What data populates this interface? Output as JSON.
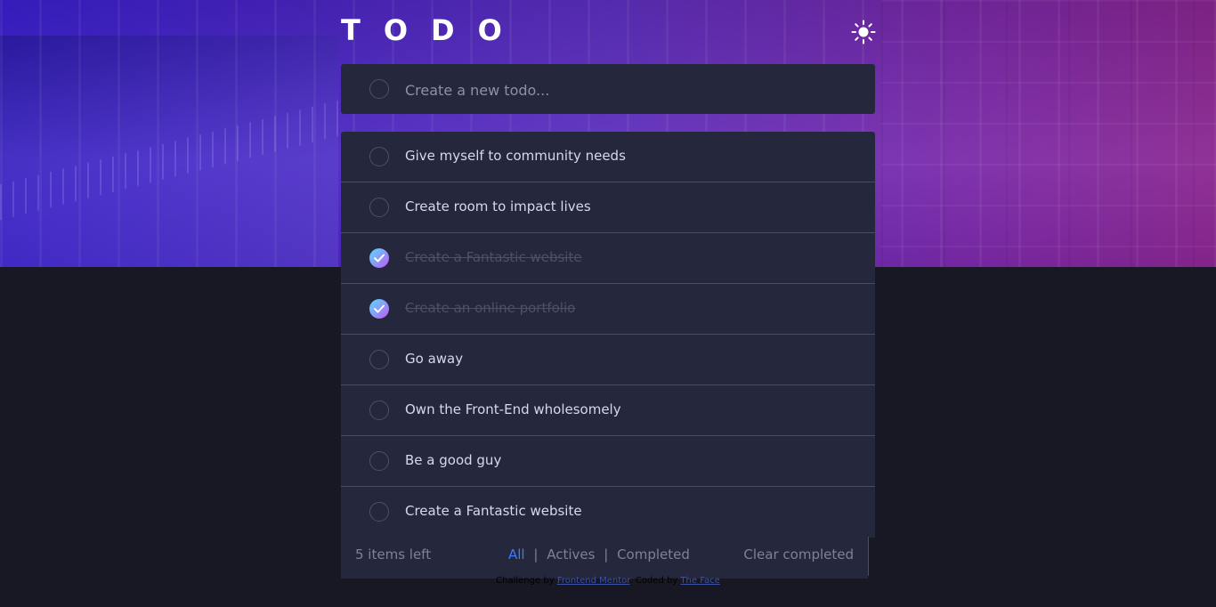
{
  "app": {
    "title": "TODO",
    "theme_icon": "sun-icon"
  },
  "colors": {
    "hero_gradient_start": "#3a1fcf",
    "hero_gradient_end": "#8a2590",
    "card_bg": "#25273c",
    "page_bg": "#181824",
    "active_filter": "#3a7cfd",
    "check_gradient_start": "#57ddff",
    "check_gradient_end": "#c058f3"
  },
  "new_todo": {
    "placeholder": "Create a new todo...",
    "value": ""
  },
  "todos": [
    {
      "text": "Give myself to community needs",
      "completed": false
    },
    {
      "text": "Create room to impact lives",
      "completed": false
    },
    {
      "text": "Create a Fantastic website",
      "completed": true
    },
    {
      "text": "Create an online portfolio",
      "completed": true
    },
    {
      "text": "Go away",
      "completed": false
    },
    {
      "text": "Own the Front-End wholesomely",
      "completed": false
    },
    {
      "text": "Be a good guy",
      "completed": false
    },
    {
      "text": "Create a Fantastic website",
      "completed": false
    }
  ],
  "footer": {
    "items_left": "5 items left",
    "filters": [
      "All",
      "Actives",
      "Completed"
    ],
    "active_filter": "All",
    "separator": "|",
    "clear_label": "Clear completed"
  },
  "attribution": {
    "prefix": "Challenge by",
    "challenge_link": "Frontend Mentor",
    "middle": ". Coded by",
    "author_link": "The Face"
  }
}
